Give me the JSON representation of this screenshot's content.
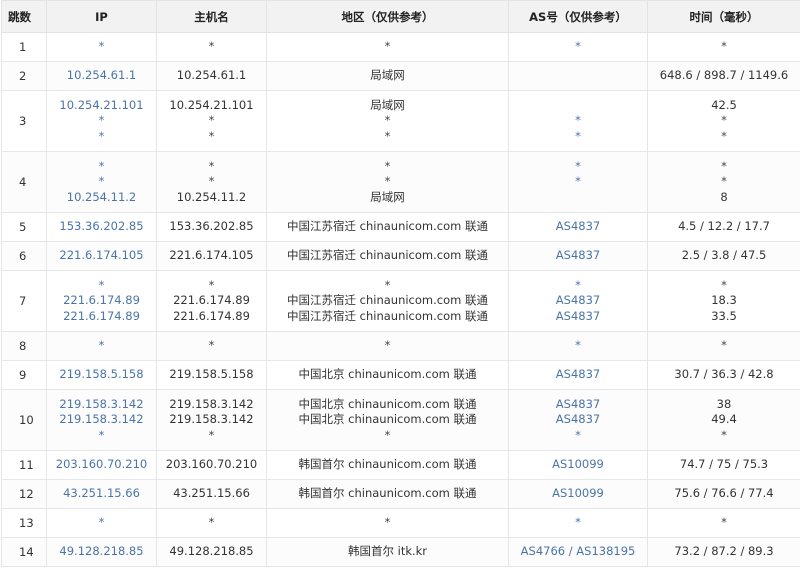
{
  "headers": [
    "跳数",
    "IP",
    "主机名",
    "地区（仅供参考）",
    "AS号（仅供参考）",
    "时间（毫秒）"
  ],
  "rows": [
    {
      "hop": "1",
      "ip": [
        "*"
      ],
      "host": [
        "*"
      ],
      "loc": [
        "*"
      ],
      "as": [
        "*"
      ],
      "time": [
        "*"
      ]
    },
    {
      "hop": "2",
      "ip": [
        "10.254.61.1"
      ],
      "host": [
        "10.254.61.1"
      ],
      "loc": [
        "局域网"
      ],
      "as": [
        ""
      ],
      "time": [
        "648.6 / 898.7 / 1149.6"
      ]
    },
    {
      "hop": "3",
      "ip": [
        "10.254.21.101",
        "*",
        "*"
      ],
      "host": [
        "10.254.21.101",
        "*",
        "*"
      ],
      "loc": [
        "局域网",
        "*",
        "*"
      ],
      "as": [
        "",
        "*",
        "*"
      ],
      "time": [
        "42.5",
        "*",
        "*"
      ]
    },
    {
      "hop": "4",
      "ip": [
        "*",
        "*",
        "10.254.11.2"
      ],
      "host": [
        "*",
        "*",
        "10.254.11.2"
      ],
      "loc": [
        "*",
        "*",
        "局域网"
      ],
      "as": [
        "*",
        "*",
        ""
      ],
      "time": [
        "*",
        "*",
        "8"
      ]
    },
    {
      "hop": "5",
      "ip": [
        "153.36.202.85"
      ],
      "host": [
        "153.36.202.85"
      ],
      "loc": [
        "中国江苏宿迁 chinaunicom.com 联通"
      ],
      "as": [
        "AS4837"
      ],
      "time": [
        "4.5 / 12.2 / 17.7"
      ]
    },
    {
      "hop": "6",
      "ip": [
        "221.6.174.105"
      ],
      "host": [
        "221.6.174.105"
      ],
      "loc": [
        "中国江苏宿迁 chinaunicom.com 联通"
      ],
      "as": [
        "AS4837"
      ],
      "time": [
        "2.5 / 3.8 / 47.5"
      ]
    },
    {
      "hop": "7",
      "ip": [
        "*",
        "221.6.174.89",
        "221.6.174.89"
      ],
      "host": [
        "*",
        "221.6.174.89",
        "221.6.174.89"
      ],
      "loc": [
        "*",
        "中国江苏宿迁 chinaunicom.com 联通",
        "中国江苏宿迁 chinaunicom.com 联通"
      ],
      "as": [
        "*",
        "AS4837",
        "AS4837"
      ],
      "time": [
        "*",
        "18.3",
        "33.5"
      ]
    },
    {
      "hop": "8",
      "ip": [
        "*"
      ],
      "host": [
        "*"
      ],
      "loc": [
        "*"
      ],
      "as": [
        "*"
      ],
      "time": [
        "*"
      ]
    },
    {
      "hop": "9",
      "ip": [
        "219.158.5.158"
      ],
      "host": [
        "219.158.5.158"
      ],
      "loc": [
        "中国北京 chinaunicom.com 联通"
      ],
      "as": [
        "AS4837"
      ],
      "time": [
        "30.7 / 36.3 / 42.8"
      ]
    },
    {
      "hop": "10",
      "ip": [
        "219.158.3.142",
        "219.158.3.142",
        "*"
      ],
      "host": [
        "219.158.3.142",
        "219.158.3.142",
        "*"
      ],
      "loc": [
        "中国北京 chinaunicom.com 联通",
        "中国北京 chinaunicom.com 联通",
        "*"
      ],
      "as": [
        "AS4837",
        "AS4837",
        "*"
      ],
      "time": [
        "38",
        "49.4",
        "*"
      ]
    },
    {
      "hop": "11",
      "ip": [
        "203.160.70.210"
      ],
      "host": [
        "203.160.70.210"
      ],
      "loc": [
        "韩国首尔 chinaunicom.com 联通"
      ],
      "as": [
        "AS10099"
      ],
      "time": [
        "74.7 / 75 / 75.3"
      ]
    },
    {
      "hop": "12",
      "ip": [
        "43.251.15.66"
      ],
      "host": [
        "43.251.15.66"
      ],
      "loc": [
        "韩国首尔 chinaunicom.com 联通"
      ],
      "as": [
        "AS10099"
      ],
      "time": [
        "75.6 / 76.6 / 77.4"
      ]
    },
    {
      "hop": "13",
      "ip": [
        "*"
      ],
      "host": [
        "*"
      ],
      "loc": [
        "*"
      ],
      "as": [
        "*"
      ],
      "time": [
        "*"
      ]
    },
    {
      "hop": "14",
      "ip": [
        "49.128.218.85"
      ],
      "host": [
        "49.128.218.85"
      ],
      "loc": [
        "韩国首尔 itk.kr"
      ],
      "as": [
        "AS4766 / AS138195"
      ],
      "time": [
        "73.2 / 87.2 / 89.3"
      ]
    }
  ]
}
